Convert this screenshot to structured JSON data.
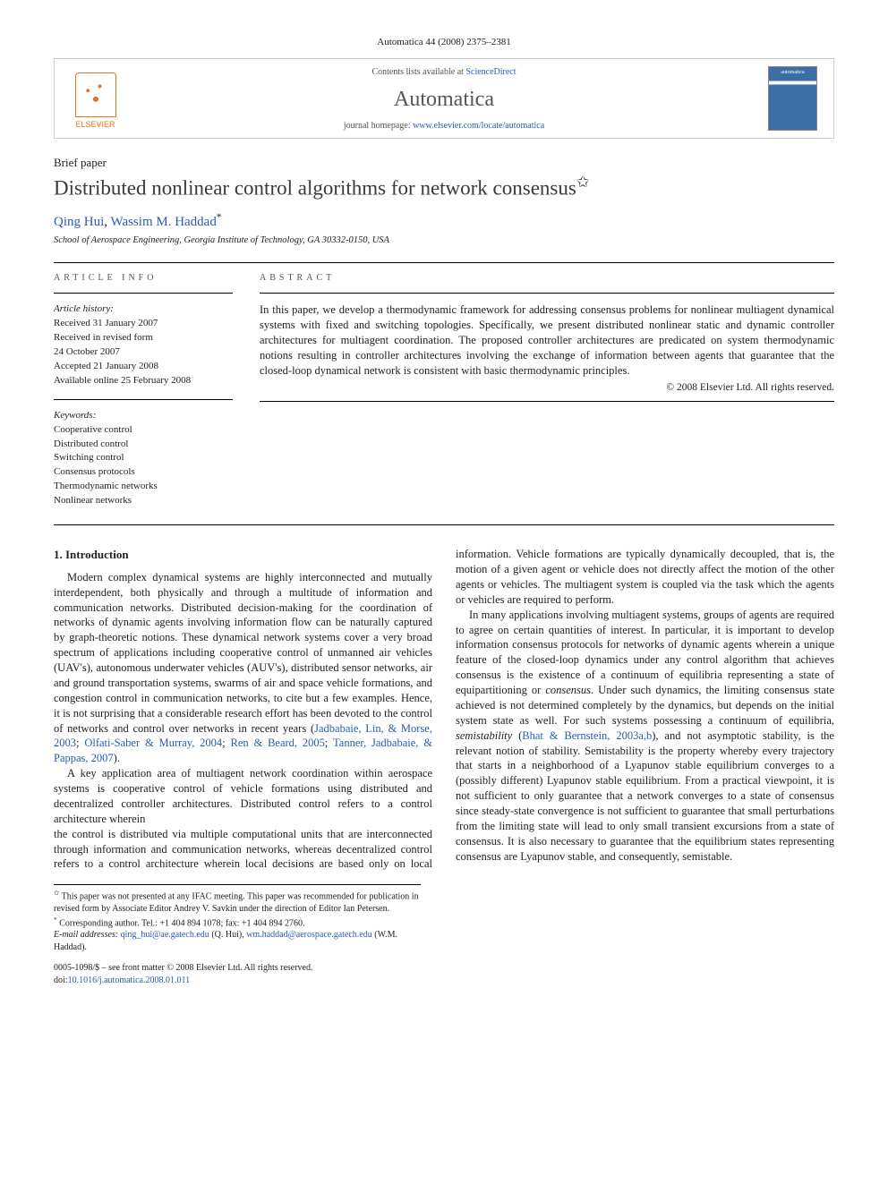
{
  "citation": "Automatica 44 (2008) 2375–2381",
  "banner": {
    "contents_prefix": "Contents lists available at ",
    "contents_link": "ScienceDirect",
    "journal": "Automatica",
    "homepage_prefix": "journal homepage: ",
    "homepage_link": "www.elsevier.com/locate/automatica",
    "publisher": "ELSEVIER",
    "cover_label": "automatica"
  },
  "paper_type": "Brief paper",
  "title": "Distributed nonlinear control algorithms for network consensus",
  "title_marker": "✩",
  "authors_html": "Qing Hui, Wassim M. Haddad",
  "authors": [
    {
      "name": "Qing Hui"
    },
    {
      "name": "Wassim M. Haddad",
      "corr": true
    }
  ],
  "affiliation": "School of Aerospace Engineering, Georgia Institute of Technology, GA 30332-0150, USA",
  "labels": {
    "article_info": "ARTICLE INFO",
    "abstract": "ABSTRACT",
    "history": "Article history:",
    "keywords": "Keywords:"
  },
  "history": [
    "Received 31 January 2007",
    "Received in revised form",
    "24 October 2007",
    "Accepted 21 January 2008",
    "Available online 25 February 2008"
  ],
  "keywords": [
    "Cooperative control",
    "Distributed control",
    "Switching control",
    "Consensus protocols",
    "Thermodynamic networks",
    "Nonlinear networks"
  ],
  "abstract": "In this paper, we develop a thermodynamic framework for addressing consensus problems for nonlinear multiagent dynamical systems with fixed and switching topologies. Specifically, we present distributed nonlinear static and dynamic controller architectures for multiagent coordination. The proposed controller architectures are predicated on system thermodynamic notions resulting in controller architectures involving the exchange of information between agents that guarantee that the closed-loop dynamical network is consistent with basic thermodynamic principles.",
  "copyright": "© 2008 Elsevier Ltd. All rights reserved.",
  "section1_heading": "1. Introduction",
  "para1a": "Modern complex dynamical systems are highly interconnected and mutually interdependent, both physically and through a multitude of information and communication networks. Distributed decision-making for the coordination of networks of dynamic agents involving information flow can be naturally captured by graph-theoretic notions. These dynamical network systems cover a very broad spectrum of applications including cooperative control of unmanned air vehicles (UAV's), autonomous underwater vehicles (AUV's), distributed sensor networks, air and ground transportation systems, swarms of air and space vehicle formations, and congestion control in communication networks, to cite but a few examples. Hence, it is not surprising that a considerable research effort has been devoted to the control of networks and control over networks in recent years (",
  "ref1": "Jadbabaie, Lin, & Morse, 2003",
  "ref2": "Olfati-Saber & Murray, 2004",
  "ref3": "Ren & Beard, 2005",
  "ref4": "Tanner, Jadbabaie, & Pappas, 2007",
  "para1b": ").",
  "para2": "A key application area of multiagent network coordination within aerospace systems is cooperative control of vehicle formations using distributed and decentralized controller architectures. Distributed control refers to a control architecture wherein",
  "para3": "the control is distributed via multiple computational units that are interconnected through information and communication networks, whereas decentralized control refers to a control architecture wherein local decisions are based only on local information. Vehicle formations are typically dynamically decoupled, that is, the motion of a given agent or vehicle does not directly affect the motion of the other agents or vehicles. The multiagent system is coupled via the task which the agents or vehicles are required to perform.",
  "para4a": "In many applications involving multiagent systems, groups of agents are required to agree on certain quantities of interest. In particular, it is important to develop information consensus protocols for networks of dynamic agents wherein a unique feature of the closed-loop dynamics under any control algorithm that achieves consensus is the existence of a continuum of equilibria representing a state of equipartitioning or ",
  "para4_em1": "consensus",
  "para4b": ". Under such dynamics, the limiting consensus state achieved is not determined completely by the dynamics, but depends on the initial system state as well. For such systems possessing a continuum of equilibria, ",
  "para4_em2": "semistability",
  "para4_ref": "Bhat & Bernstein, 2003a,b",
  "para4c": "), and not asymptotic stability, is the relevant notion of stability. Semistability is the property whereby every trajectory that starts in a neighborhood of a Lyapunov stable equilibrium converges to a (possibly different) Lyapunov stable equilibrium. From a practical viewpoint, it is not sufficient to only guarantee that a network converges to a state of consensus since steady-state convergence is not sufficient to guarantee that small perturbations from the limiting state will lead to only small transient excursions from a state of consensus. It is also necessary to guarantee that the equilibrium states representing consensus are Lyapunov stable, and consequently, semistable.",
  "footnotes": {
    "star": "This paper was not presented at any IFAC meeting. This paper was recommended for publication in revised form by Associate Editor Andrey V. Savkin under the direction of Editor Ian Petersen.",
    "corr": "Corresponding author. Tel.: +1 404 894 1078; fax: +1 404 894 2760.",
    "email_label": "E-mail addresses:",
    "email1": "qing_hui@ae.gatech.edu",
    "email1_who": "(Q. Hui),",
    "email2": "wm.haddad@aerospace.gatech.edu",
    "email2_who": "(W.M. Haddad)."
  },
  "footer": {
    "line1": "0005-1098/$ – see front matter © 2008 Elsevier Ltd. All rights reserved.",
    "doi_label": "doi:",
    "doi": "10.1016/j.automatica.2008.01.011"
  }
}
